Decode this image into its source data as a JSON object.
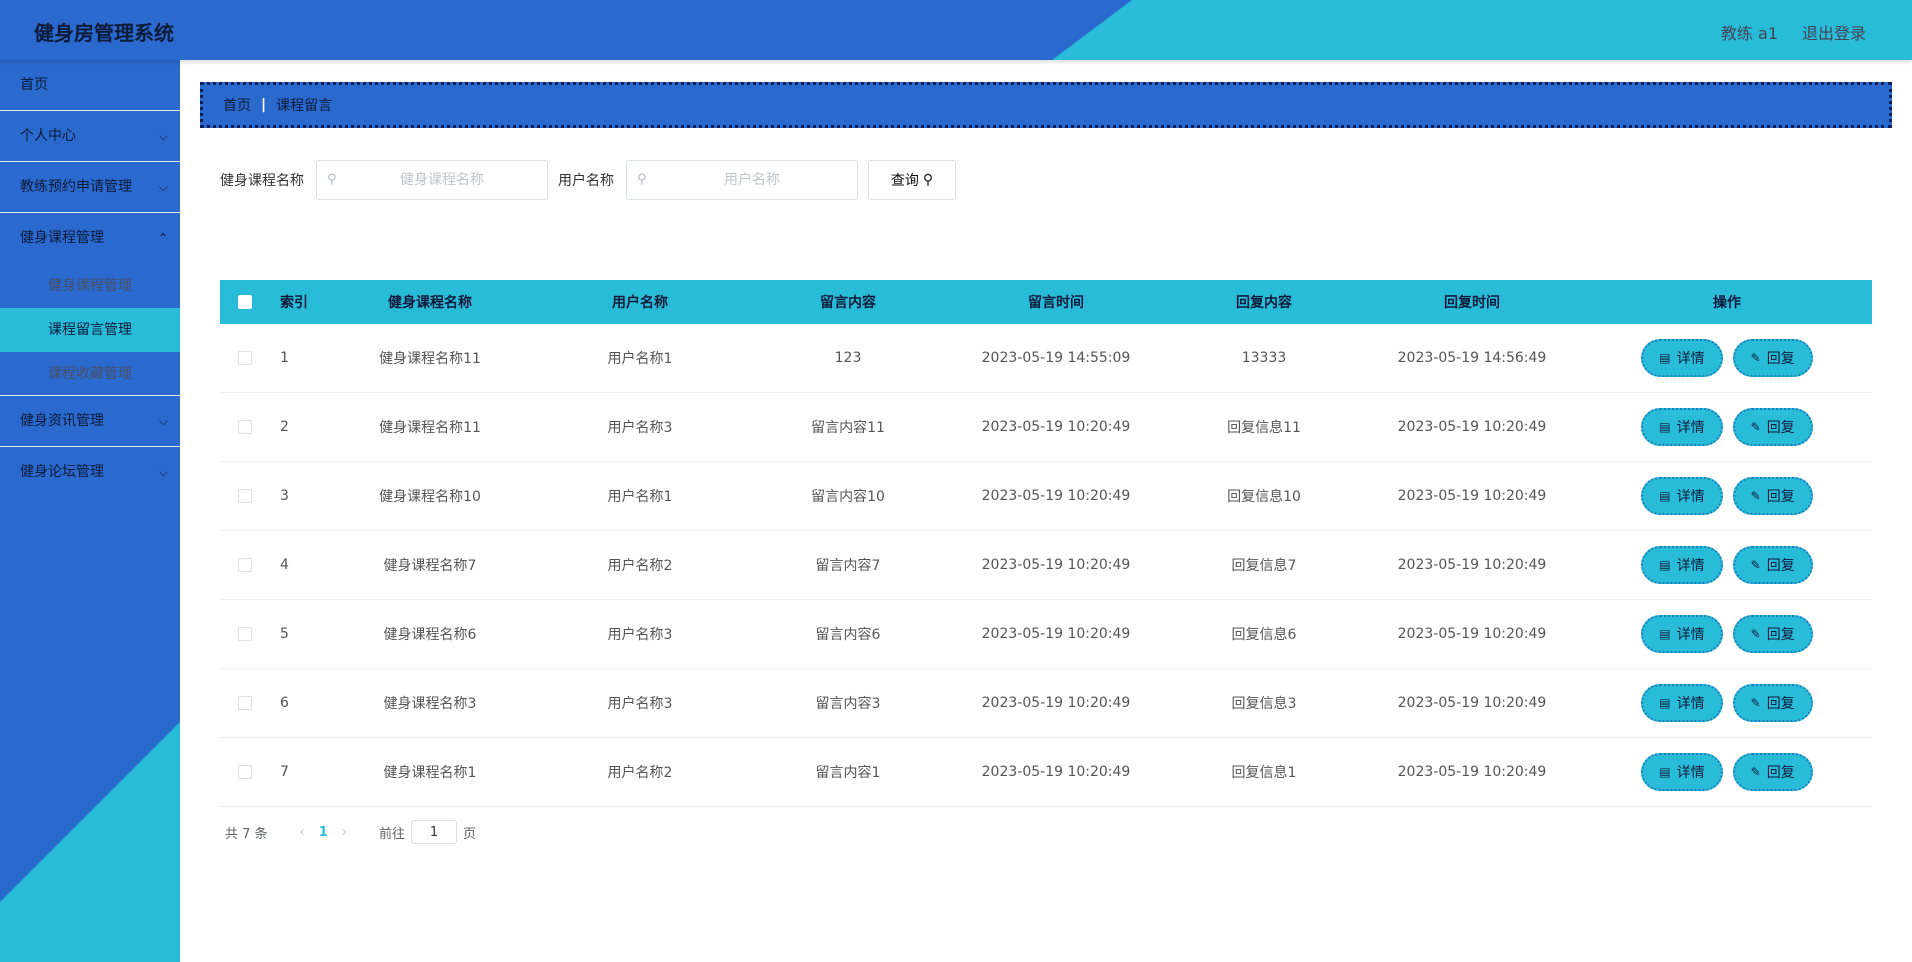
{
  "header": {
    "title": "健身房管理系统",
    "user": "教练 a1",
    "logout": "退出登录"
  },
  "sidebar": {
    "items": [
      {
        "label": "首页"
      },
      {
        "label": "个人中心"
      },
      {
        "label": "教练预约申请管理"
      },
      {
        "label": "健身课程管理",
        "children": [
          "健身课程管理",
          "课程留言管理",
          "课程收藏管理"
        ]
      },
      {
        "label": "健身资讯管理"
      },
      {
        "label": "健身论坛管理"
      }
    ]
  },
  "breadcrumb": {
    "home": "首页",
    "current": "课程留言"
  },
  "search": {
    "course_label": "健身课程名称",
    "course_placeholder": "健身课程名称",
    "user_label": "用户名称",
    "user_placeholder": "用户名称",
    "query_label": "查询"
  },
  "table": {
    "headers": [
      "索引",
      "健身课程名称",
      "用户名称",
      "留言内容",
      "留言时间",
      "回复内容",
      "回复时间",
      "操作"
    ],
    "detail_label": "详情",
    "reply_label": "回复",
    "rows": [
      {
        "index": "1",
        "course": "健身课程名称11",
        "user": "用户名称1",
        "content": "123",
        "time": "2023-05-19 14:55:09",
        "reply": "13333",
        "reply_time": "2023-05-19 14:56:49"
      },
      {
        "index": "2",
        "course": "健身课程名称11",
        "user": "用户名称3",
        "content": "留言内容11",
        "time": "2023-05-19 10:20:49",
        "reply": "回复信息11",
        "reply_time": "2023-05-19 10:20:49"
      },
      {
        "index": "3",
        "course": "健身课程名称10",
        "user": "用户名称1",
        "content": "留言内容10",
        "time": "2023-05-19 10:20:49",
        "reply": "回复信息10",
        "reply_time": "2023-05-19 10:20:49"
      },
      {
        "index": "4",
        "course": "健身课程名称7",
        "user": "用户名称2",
        "content": "留言内容7",
        "time": "2023-05-19 10:20:49",
        "reply": "回复信息7",
        "reply_time": "2023-05-19 10:20:49"
      },
      {
        "index": "5",
        "course": "健身课程名称6",
        "user": "用户名称3",
        "content": "留言内容6",
        "time": "2023-05-19 10:20:49",
        "reply": "回复信息6",
        "reply_time": "2023-05-19 10:20:49"
      },
      {
        "index": "6",
        "course": "健身课程名称3",
        "user": "用户名称3",
        "content": "留言内容3",
        "time": "2023-05-19 10:20:49",
        "reply": "回复信息3",
        "reply_time": "2023-05-19 10:20:49"
      },
      {
        "index": "7",
        "course": "健身课程名称1",
        "user": "用户名称2",
        "content": "留言内容1",
        "time": "2023-05-19 10:20:49",
        "reply": "回复信息1",
        "reply_time": "2023-05-19 10:20:49"
      }
    ]
  },
  "pagination": {
    "total": "共 7 条",
    "current_page": "1",
    "goto_prefix": "前往",
    "goto_value": "1",
    "goto_suffix": "页"
  },
  "colors": {
    "primary_blue": "#2a69cd",
    "accent_cyan": "#29bcd9"
  }
}
